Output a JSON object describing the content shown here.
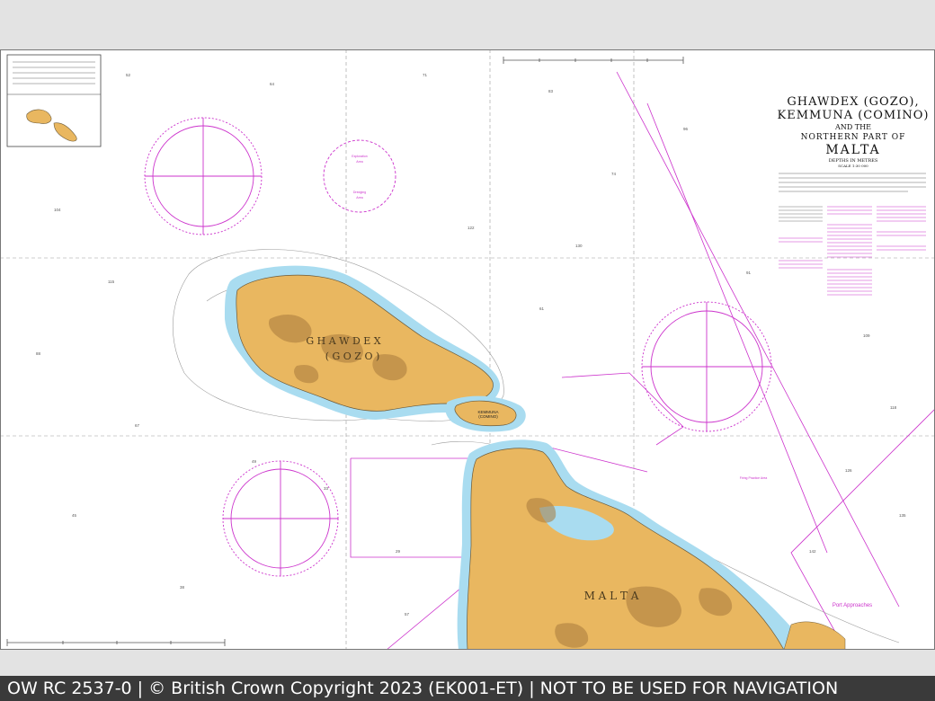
{
  "chart": {
    "title_line1": "GHAWDEX (GOZO),",
    "title_line2": "KEMMUNA (COMINO)",
    "title_line3": "AND THE",
    "title_line4": "NORTHERN PART OF",
    "title_line5": "MALTA",
    "depths_note": "DEPTHS IN METRES",
    "scale_note": "SCALE 1:30 000",
    "island_gozo": "G H A W D E X",
    "island_gozo_alt": "( G O Z O )",
    "island_comino": "KEMMUNA",
    "island_comino_alt": "(COMINO)",
    "island_malta": "M A L T A",
    "port_label": "Port Approaches",
    "firing_label": "Firing Practice Area",
    "compass_labels": [
      "Exploration",
      "Area",
      "Dredging",
      "Area"
    ],
    "depth_samples": [
      "52",
      "64",
      "71",
      "83",
      "96",
      "104",
      "115",
      "122",
      "130",
      "88",
      "67",
      "45",
      "38",
      "29",
      "57",
      "74",
      "91",
      "109",
      "118",
      "126",
      "135",
      "142",
      "61",
      "49",
      "33"
    ],
    "colors": {
      "land": "#e9b760",
      "land_dark": "#a87a3c",
      "shallow": "#a9dcf0",
      "magenta": "#cc33cc",
      "grid": "#888888",
      "sea": "#ffffff"
    }
  },
  "footer": {
    "text": "OW RC 2537-0 | © British Crown Copyright 2023 (EK001-ET) | NOT TO BE USED FOR NAVIGATION"
  }
}
